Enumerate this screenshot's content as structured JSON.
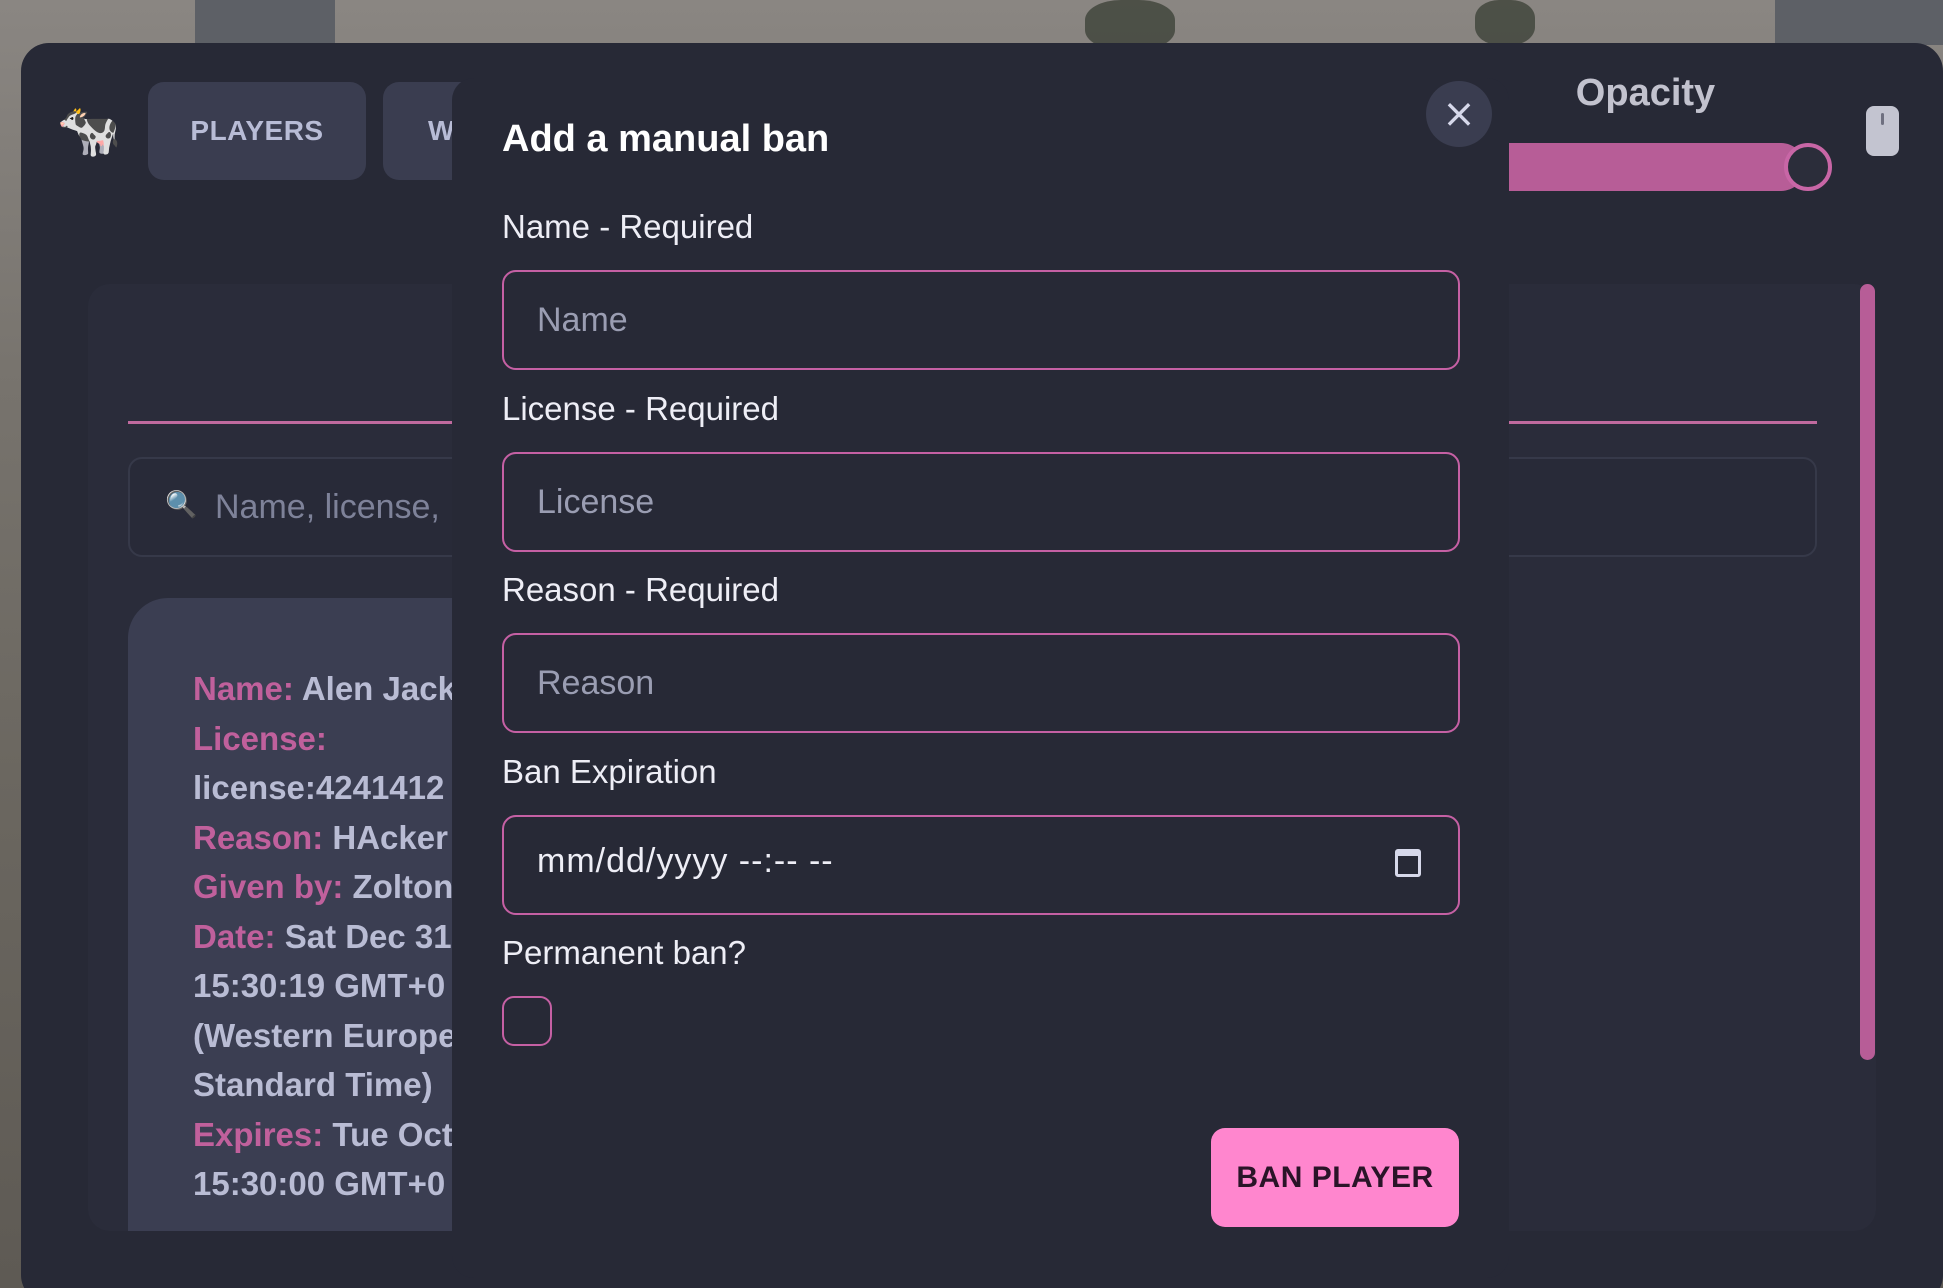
{
  "nav": {
    "logo": "🐄",
    "tabs": [
      {
        "label": "PLAYERS"
      },
      {
        "label": "W"
      }
    ]
  },
  "opacity": {
    "label": "Opacity",
    "value_fraction": 0.9
  },
  "search": {
    "icon": "🔍",
    "placeholder": "Name, license,"
  },
  "ban_record": {
    "name_label": "Name:",
    "name_value": "Alen Jack",
    "license_label": "License:",
    "license_value": "license:4241412",
    "reason_label": "Reason:",
    "reason_value": "HAcker",
    "given_by_label": "Given by:",
    "given_by_value": "Zolton",
    "date_label": "Date:",
    "date_value_line1": "Sat Dec 31",
    "date_value_line2": "15:30:19 GMT+0",
    "date_value_line3": "(Western Europe",
    "date_value_line4": "Standard Time)",
    "expires_label": "Expires:",
    "expires_value_line1": "Tue Oct",
    "expires_value_line2": "15:30:00 GMT+0"
  },
  "modal": {
    "title": "Add a manual ban",
    "close_icon": "×",
    "fields": {
      "name_label": "Name - Required",
      "name_placeholder": "Name",
      "license_label": "License - Required",
      "license_placeholder": "License",
      "reason_label": "Reason - Required",
      "reason_placeholder": "Reason",
      "expiration_label": "Ban Expiration",
      "expiration_value": "mm/dd/yyyy --:-- --",
      "permanent_label": "Permanent ban?"
    },
    "submit_label": "BAN PLAYER"
  },
  "colors": {
    "accent": "#c560a4",
    "button": "#ff86ce",
    "panel": "#272936"
  }
}
